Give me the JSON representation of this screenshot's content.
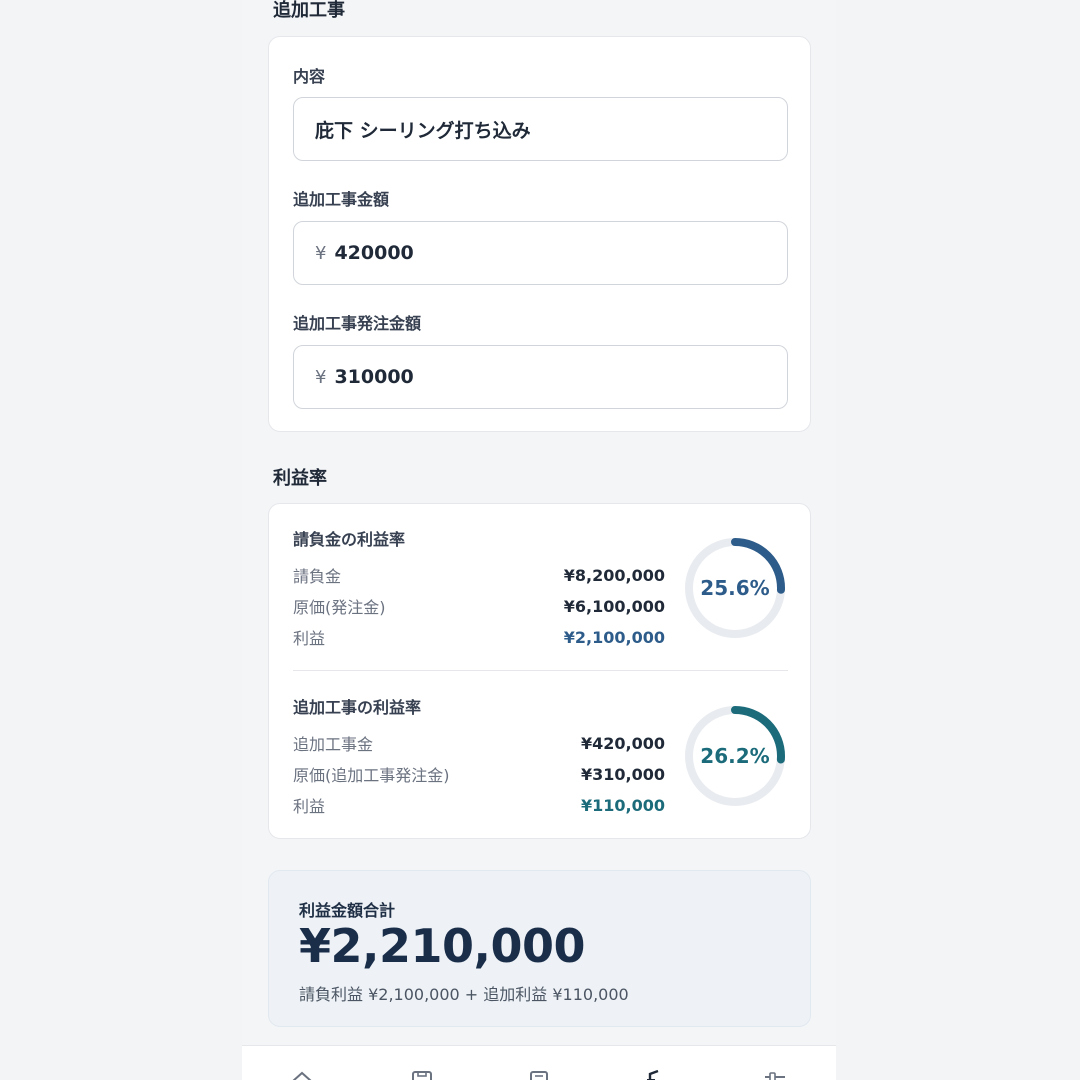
{
  "sections": {
    "additional_work_title": "追加工事",
    "profit_rate_title": "利益率"
  },
  "additional_work": {
    "content_label": "内容",
    "content_value": "庇下 シーリング打ち込み",
    "amount_label": "追加工事金額",
    "amount_currency": "¥",
    "amount_value": "420000",
    "order_amount_label": "追加工事発注金額",
    "order_amount_currency": "¥",
    "order_amount_value": "310000"
  },
  "contract_profit": {
    "title": "請負金の利益率",
    "rows": [
      {
        "label": "請負金",
        "value": "¥8,200,000"
      },
      {
        "label": "原価(発注金)",
        "value": "¥6,100,000"
      },
      {
        "label": "利益",
        "value": "¥2,100,000"
      }
    ],
    "percent_text": "25.6%",
    "percent": 25.6,
    "color": "#2d5c8a"
  },
  "additional_profit": {
    "title": "追加工事の利益率",
    "rows": [
      {
        "label": "追加工事金",
        "value": "¥420,000"
      },
      {
        "label": "原価(追加工事発注金)",
        "value": "¥310,000"
      },
      {
        "label": "利益",
        "value": "¥110,000"
      }
    ],
    "percent_text": "26.2%",
    "percent": 26.2,
    "color": "#1b6b7b"
  },
  "total": {
    "label": "利益金額合計",
    "amount": "¥2,210,000",
    "breakdown": "請負利益 ¥2,100,000 + 追加利益 ¥110,000"
  },
  "bottom_nav": {
    "icons": [
      "home-icon",
      "save-icon",
      "calculator-icon",
      "chart-icon",
      "settings-icon"
    ]
  }
}
